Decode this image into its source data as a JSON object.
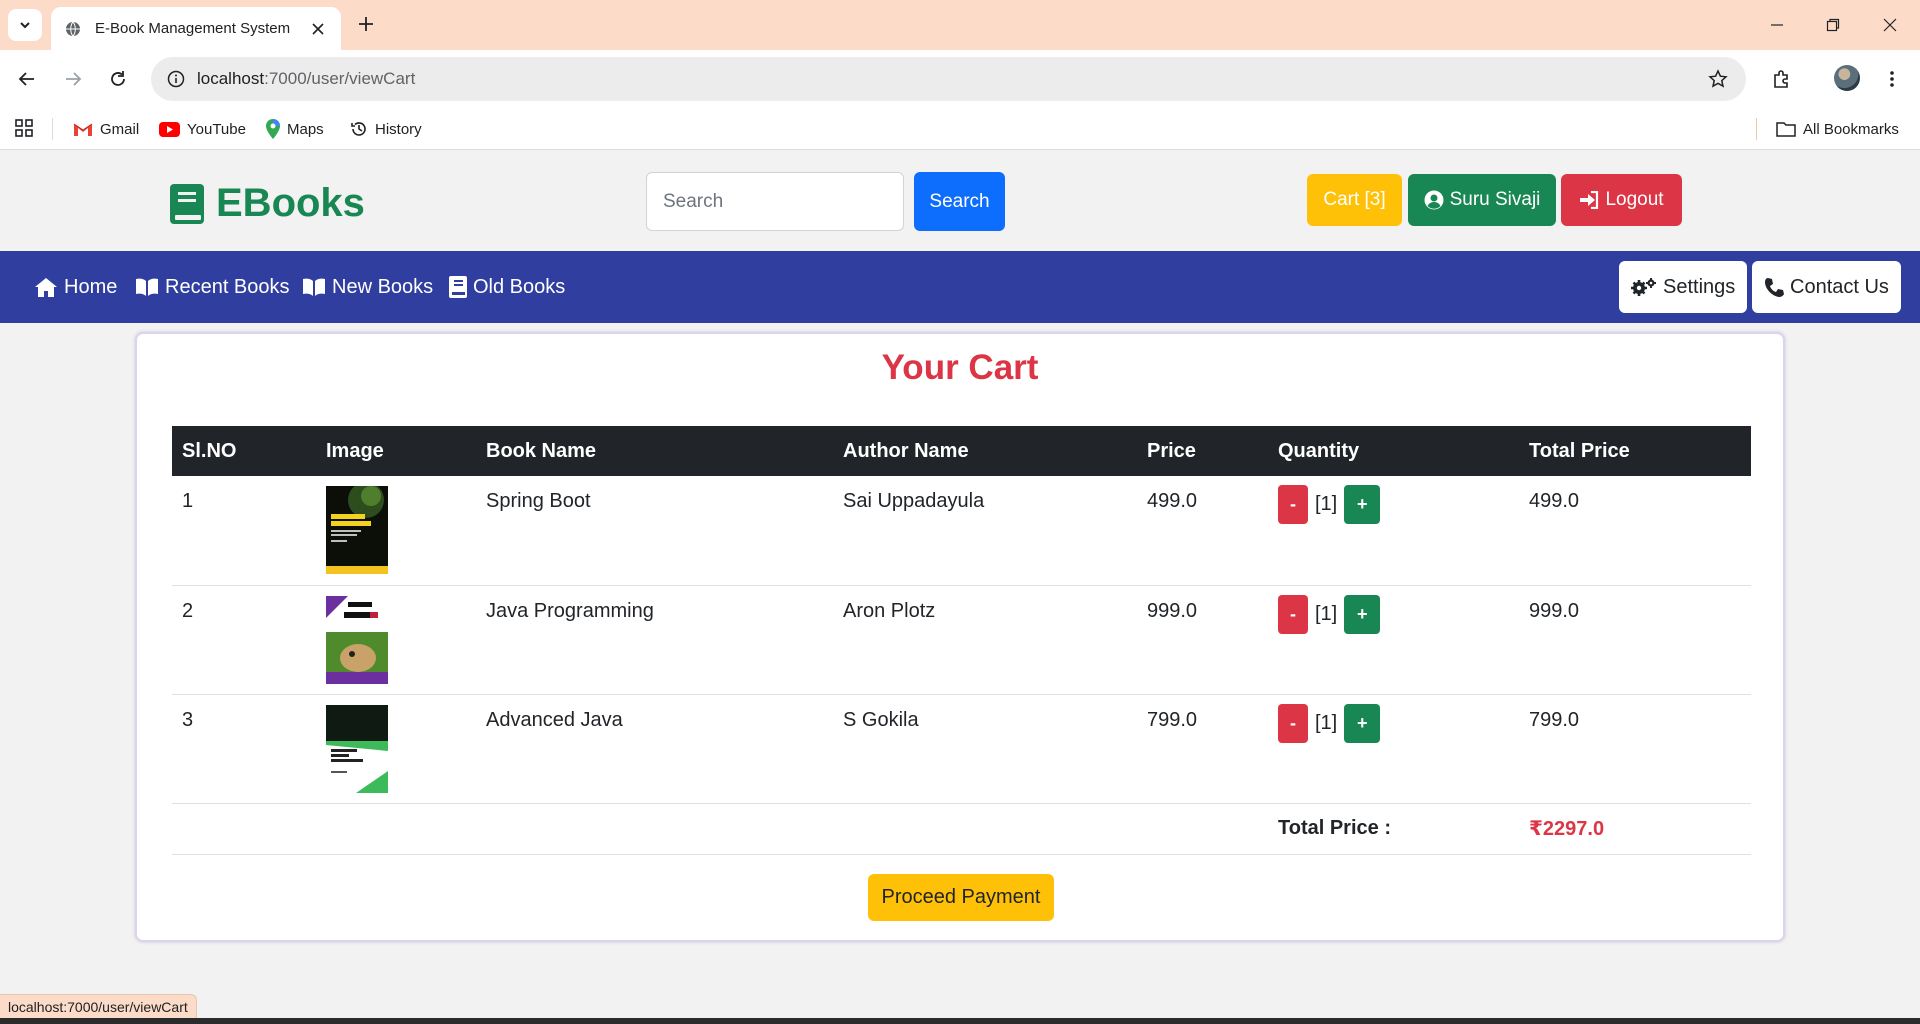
{
  "browser": {
    "tab_title": "E-Book Management System",
    "url_host": "localhost",
    "url_path": ":7000/user/viewCart",
    "bookmarks": [
      "Gmail",
      "YouTube",
      "Maps",
      "History"
    ],
    "all_bookmarks": "All Bookmarks",
    "status_url": "localhost:7000/user/viewCart"
  },
  "header": {
    "brand": "EBooks",
    "search_placeholder": "Search",
    "search_button": "Search",
    "cart_button": "Cart [3]",
    "user_button": "Suru Sivaji",
    "logout_button": "Logout"
  },
  "nav": {
    "home": "Home",
    "recent": "Recent Books",
    "new": "New Books",
    "old": "Old Books",
    "settings": "Settings",
    "contact": "Contact Us"
  },
  "cart": {
    "title": "Your Cart",
    "columns": [
      "Sl.NO",
      "Image",
      "Book Name",
      "Author Name",
      "Price",
      "Quantity",
      "Total Price"
    ],
    "items": [
      {
        "no": "1",
        "name": "Spring Boot",
        "author": "Sai Uppadayula",
        "price": "499.0",
        "qty": "[1]",
        "total": "499.0",
        "cover": "spring-boot-book-cover"
      },
      {
        "no": "2",
        "name": "Java Programming",
        "author": "Aron Plotz",
        "price": "999.0",
        "qty": "[1]",
        "total": "999.0",
        "cover": "java-21-book-cover"
      },
      {
        "no": "3",
        "name": "Advanced Java",
        "author": "S Gokila",
        "price": "799.0",
        "qty": "[1]",
        "total": "799.0",
        "cover": "advanced-java-book-cover"
      }
    ],
    "minus_label": "-",
    "plus_label": "+",
    "total_label": "Total Price :",
    "total_value": "₹2297.0",
    "pay_button": "Proceed Payment"
  },
  "colors": {
    "brand": "#198754",
    "nav_bg": "#303f9f",
    "danger": "#dc3545",
    "warning": "#ffc107",
    "primary": "#0d6efd"
  }
}
